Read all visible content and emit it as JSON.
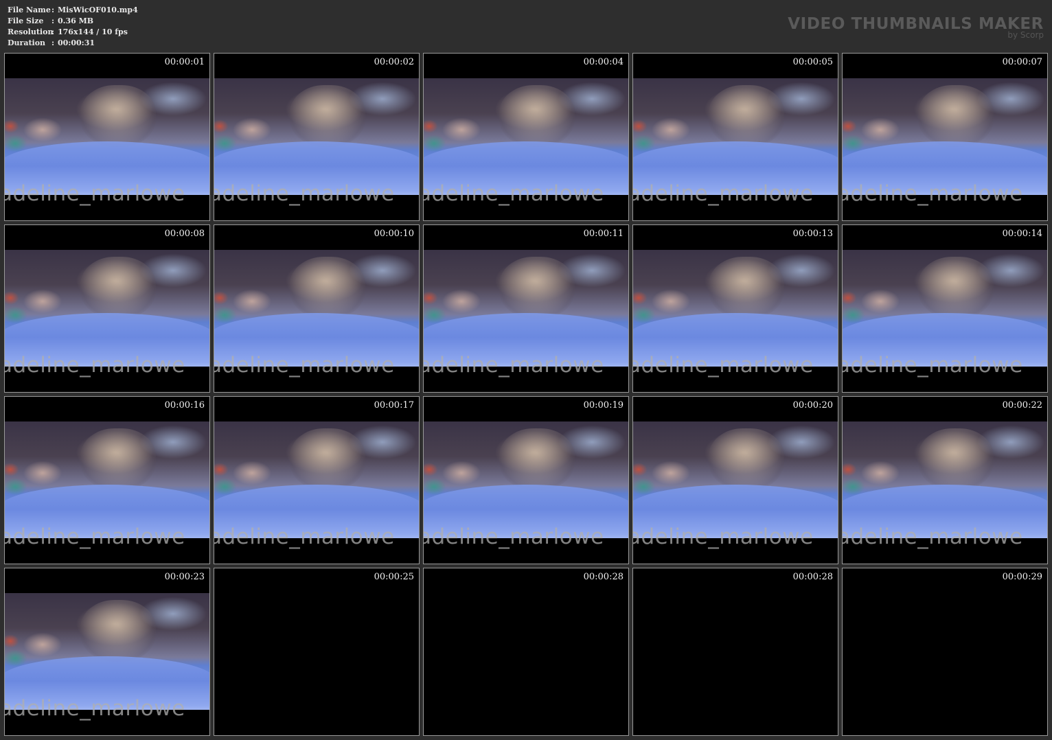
{
  "info": [
    {
      "key": "File Name",
      "sep": ":",
      "value": "MisWicOF010.mp4"
    },
    {
      "key": "File Size",
      "sep": ":",
      "value": "0.36 MB"
    },
    {
      "key": "Resolution",
      "sep": ":",
      "value": "176x144 / 10 fps"
    },
    {
      "key": "Duration",
      "sep": ":",
      "value": "00:00:31"
    }
  ],
  "brand": {
    "title": "VIDEO THUMBNAILS MAKER",
    "subtitle": "by Scorp"
  },
  "watermark_text": "adeline_marlowe",
  "thumbnails": [
    {
      "time": "00:00:01",
      "has_frame": true
    },
    {
      "time": "00:00:02",
      "has_frame": true
    },
    {
      "time": "00:00:04",
      "has_frame": true
    },
    {
      "time": "00:00:05",
      "has_frame": true
    },
    {
      "time": "00:00:07",
      "has_frame": true
    },
    {
      "time": "00:00:08",
      "has_frame": true
    },
    {
      "time": "00:00:10",
      "has_frame": true
    },
    {
      "time": "00:00:11",
      "has_frame": true
    },
    {
      "time": "00:00:13",
      "has_frame": true
    },
    {
      "time": "00:00:14",
      "has_frame": true
    },
    {
      "time": "00:00:16",
      "has_frame": true
    },
    {
      "time": "00:00:17",
      "has_frame": true
    },
    {
      "time": "00:00:19",
      "has_frame": true
    },
    {
      "time": "00:00:20",
      "has_frame": true
    },
    {
      "time": "00:00:22",
      "has_frame": true
    },
    {
      "time": "00:00:23",
      "has_frame": true
    },
    {
      "time": "00:00:25",
      "has_frame": false
    },
    {
      "time": "00:00:28",
      "has_frame": false
    },
    {
      "time": "00:00:28",
      "has_frame": false
    },
    {
      "time": "00:00:29",
      "has_frame": false
    }
  ]
}
